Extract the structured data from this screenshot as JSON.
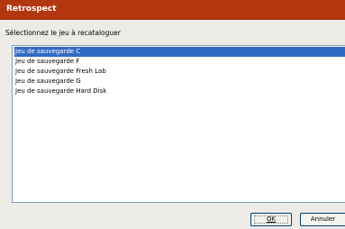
{
  "window": {
    "title": "Retrospect"
  },
  "dialog": {
    "prompt": "Sélectionnez le jeu à recataloguer",
    "items": [
      {
        "label": "Jeu de sauvegarde C",
        "selected": true
      },
      {
        "label": "Jeu de sauvegarde F",
        "selected": false
      },
      {
        "label": "Jeu de sauvegarde Fresh Lab",
        "selected": false
      },
      {
        "label": "Jeu de sauvegarde G",
        "selected": false
      },
      {
        "label": "Jeu de sauvegarde Hard Disk",
        "selected": false
      }
    ],
    "ok_label": "OK",
    "cancel_label": "Annuler"
  },
  "colors": {
    "titlebar": "#b3370e",
    "selection": "#316ac5",
    "dialog_bg": "#ecebe6"
  }
}
